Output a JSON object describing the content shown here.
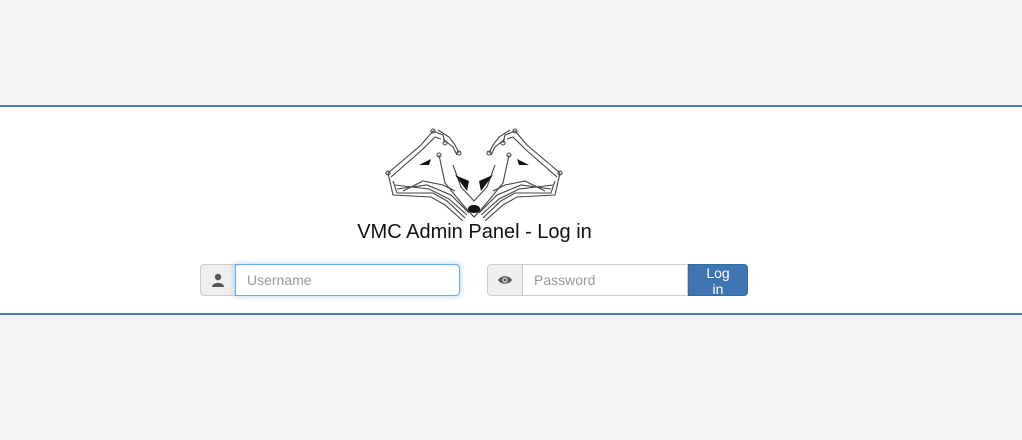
{
  "header": {
    "title": "VMC Admin Panel - Log in"
  },
  "login_form": {
    "username": {
      "icon": "user-icon",
      "value": "",
      "placeholder": "Username"
    },
    "password": {
      "icon": "eye-icon",
      "value": "",
      "placeholder": "Password"
    },
    "submit_label": "Log in"
  },
  "colors": {
    "accent": "#3f74b3",
    "band_border": "#4f7db8",
    "page_background": "#f5f5f5",
    "focus_ring": "#66afe9"
  }
}
